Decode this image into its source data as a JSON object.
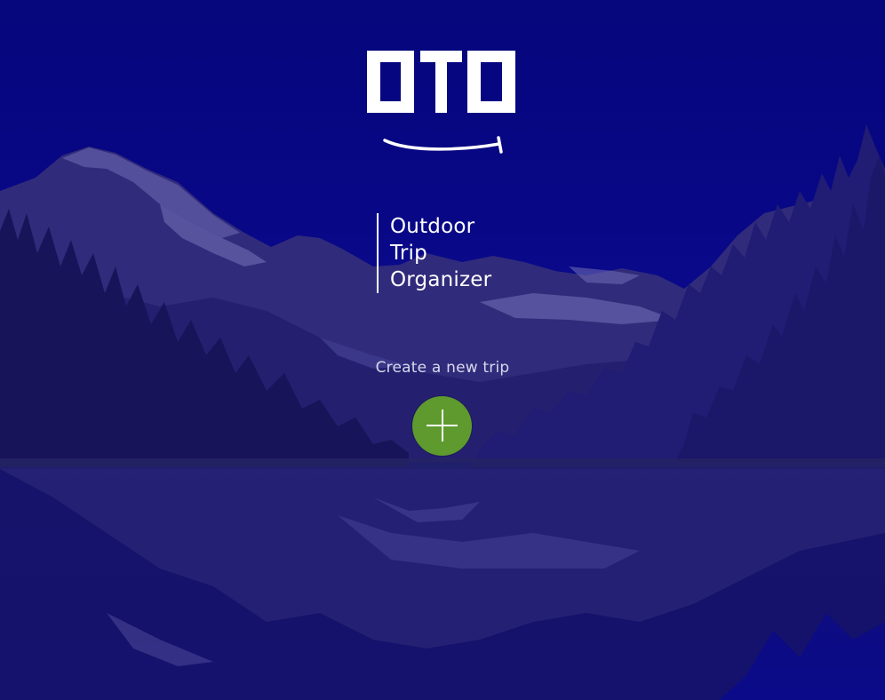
{
  "app": {
    "logo_text": "OTO",
    "tagline": [
      "Outdoor",
      "Trip",
      "Organizer"
    ]
  },
  "create": {
    "label": "Create a new trip",
    "button_icon": "plus-icon"
  },
  "colors": {
    "background": "#0a0a8e",
    "accent_button": "#5e9a2e",
    "text": "#ffffff"
  },
  "background_image": "mountain-lake-reflection"
}
